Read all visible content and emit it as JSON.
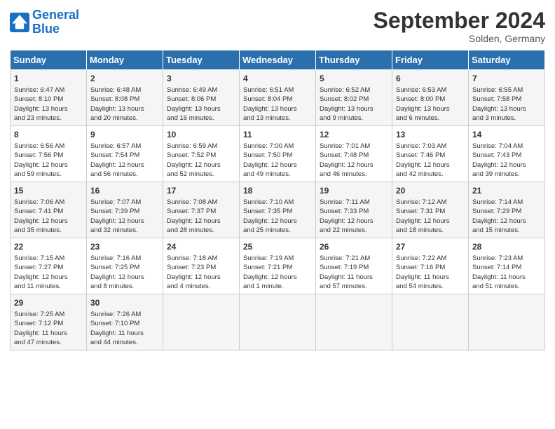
{
  "header": {
    "logo_line1": "General",
    "logo_line2": "Blue",
    "month_title": "September 2024",
    "location": "Solden, Germany"
  },
  "weekdays": [
    "Sunday",
    "Monday",
    "Tuesday",
    "Wednesday",
    "Thursday",
    "Friday",
    "Saturday"
  ],
  "weeks": [
    [
      {
        "day": "1",
        "lines": [
          "Sunrise: 6:47 AM",
          "Sunset: 8:10 PM",
          "Daylight: 13 hours",
          "and 23 minutes."
        ]
      },
      {
        "day": "2",
        "lines": [
          "Sunrise: 6:48 AM",
          "Sunset: 8:08 PM",
          "Daylight: 13 hours",
          "and 20 minutes."
        ]
      },
      {
        "day": "3",
        "lines": [
          "Sunrise: 6:49 AM",
          "Sunset: 8:06 PM",
          "Daylight: 13 hours",
          "and 16 minutes."
        ]
      },
      {
        "day": "4",
        "lines": [
          "Sunrise: 6:51 AM",
          "Sunset: 8:04 PM",
          "Daylight: 13 hours",
          "and 13 minutes."
        ]
      },
      {
        "day": "5",
        "lines": [
          "Sunrise: 6:52 AM",
          "Sunset: 8:02 PM",
          "Daylight: 13 hours",
          "and 9 minutes."
        ]
      },
      {
        "day": "6",
        "lines": [
          "Sunrise: 6:53 AM",
          "Sunset: 8:00 PM",
          "Daylight: 13 hours",
          "and 6 minutes."
        ]
      },
      {
        "day": "7",
        "lines": [
          "Sunrise: 6:55 AM",
          "Sunset: 7:58 PM",
          "Daylight: 13 hours",
          "and 3 minutes."
        ]
      }
    ],
    [
      {
        "day": "8",
        "lines": [
          "Sunrise: 6:56 AM",
          "Sunset: 7:56 PM",
          "Daylight: 12 hours",
          "and 59 minutes."
        ]
      },
      {
        "day": "9",
        "lines": [
          "Sunrise: 6:57 AM",
          "Sunset: 7:54 PM",
          "Daylight: 12 hours",
          "and 56 minutes."
        ]
      },
      {
        "day": "10",
        "lines": [
          "Sunrise: 6:59 AM",
          "Sunset: 7:52 PM",
          "Daylight: 12 hours",
          "and 52 minutes."
        ]
      },
      {
        "day": "11",
        "lines": [
          "Sunrise: 7:00 AM",
          "Sunset: 7:50 PM",
          "Daylight: 12 hours",
          "and 49 minutes."
        ]
      },
      {
        "day": "12",
        "lines": [
          "Sunrise: 7:01 AM",
          "Sunset: 7:48 PM",
          "Daylight: 12 hours",
          "and 46 minutes."
        ]
      },
      {
        "day": "13",
        "lines": [
          "Sunrise: 7:03 AM",
          "Sunset: 7:46 PM",
          "Daylight: 12 hours",
          "and 42 minutes."
        ]
      },
      {
        "day": "14",
        "lines": [
          "Sunrise: 7:04 AM",
          "Sunset: 7:43 PM",
          "Daylight: 12 hours",
          "and 39 minutes."
        ]
      }
    ],
    [
      {
        "day": "15",
        "lines": [
          "Sunrise: 7:06 AM",
          "Sunset: 7:41 PM",
          "Daylight: 12 hours",
          "and 35 minutes."
        ]
      },
      {
        "day": "16",
        "lines": [
          "Sunrise: 7:07 AM",
          "Sunset: 7:39 PM",
          "Daylight: 12 hours",
          "and 32 minutes."
        ]
      },
      {
        "day": "17",
        "lines": [
          "Sunrise: 7:08 AM",
          "Sunset: 7:37 PM",
          "Daylight: 12 hours",
          "and 28 minutes."
        ]
      },
      {
        "day": "18",
        "lines": [
          "Sunrise: 7:10 AM",
          "Sunset: 7:35 PM",
          "Daylight: 12 hours",
          "and 25 minutes."
        ]
      },
      {
        "day": "19",
        "lines": [
          "Sunrise: 7:11 AM",
          "Sunset: 7:33 PM",
          "Daylight: 12 hours",
          "and 22 minutes."
        ]
      },
      {
        "day": "20",
        "lines": [
          "Sunrise: 7:12 AM",
          "Sunset: 7:31 PM",
          "Daylight: 12 hours",
          "and 18 minutes."
        ]
      },
      {
        "day": "21",
        "lines": [
          "Sunrise: 7:14 AM",
          "Sunset: 7:29 PM",
          "Daylight: 12 hours",
          "and 15 minutes."
        ]
      }
    ],
    [
      {
        "day": "22",
        "lines": [
          "Sunrise: 7:15 AM",
          "Sunset: 7:27 PM",
          "Daylight: 12 hours",
          "and 11 minutes."
        ]
      },
      {
        "day": "23",
        "lines": [
          "Sunrise: 7:16 AM",
          "Sunset: 7:25 PM",
          "Daylight: 12 hours",
          "and 8 minutes."
        ]
      },
      {
        "day": "24",
        "lines": [
          "Sunrise: 7:18 AM",
          "Sunset: 7:23 PM",
          "Daylight: 12 hours",
          "and 4 minutes."
        ]
      },
      {
        "day": "25",
        "lines": [
          "Sunrise: 7:19 AM",
          "Sunset: 7:21 PM",
          "Daylight: 12 hours",
          "and 1 minute."
        ]
      },
      {
        "day": "26",
        "lines": [
          "Sunrise: 7:21 AM",
          "Sunset: 7:19 PM",
          "Daylight: 11 hours",
          "and 57 minutes."
        ]
      },
      {
        "day": "27",
        "lines": [
          "Sunrise: 7:22 AM",
          "Sunset: 7:16 PM",
          "Daylight: 11 hours",
          "and 54 minutes."
        ]
      },
      {
        "day": "28",
        "lines": [
          "Sunrise: 7:23 AM",
          "Sunset: 7:14 PM",
          "Daylight: 11 hours",
          "and 51 minutes."
        ]
      }
    ],
    [
      {
        "day": "29",
        "lines": [
          "Sunrise: 7:25 AM",
          "Sunset: 7:12 PM",
          "Daylight: 11 hours",
          "and 47 minutes."
        ]
      },
      {
        "day": "30",
        "lines": [
          "Sunrise: 7:26 AM",
          "Sunset: 7:10 PM",
          "Daylight: 11 hours",
          "and 44 minutes."
        ]
      },
      {
        "day": "",
        "lines": []
      },
      {
        "day": "",
        "lines": []
      },
      {
        "day": "",
        "lines": []
      },
      {
        "day": "",
        "lines": []
      },
      {
        "day": "",
        "lines": []
      }
    ]
  ]
}
